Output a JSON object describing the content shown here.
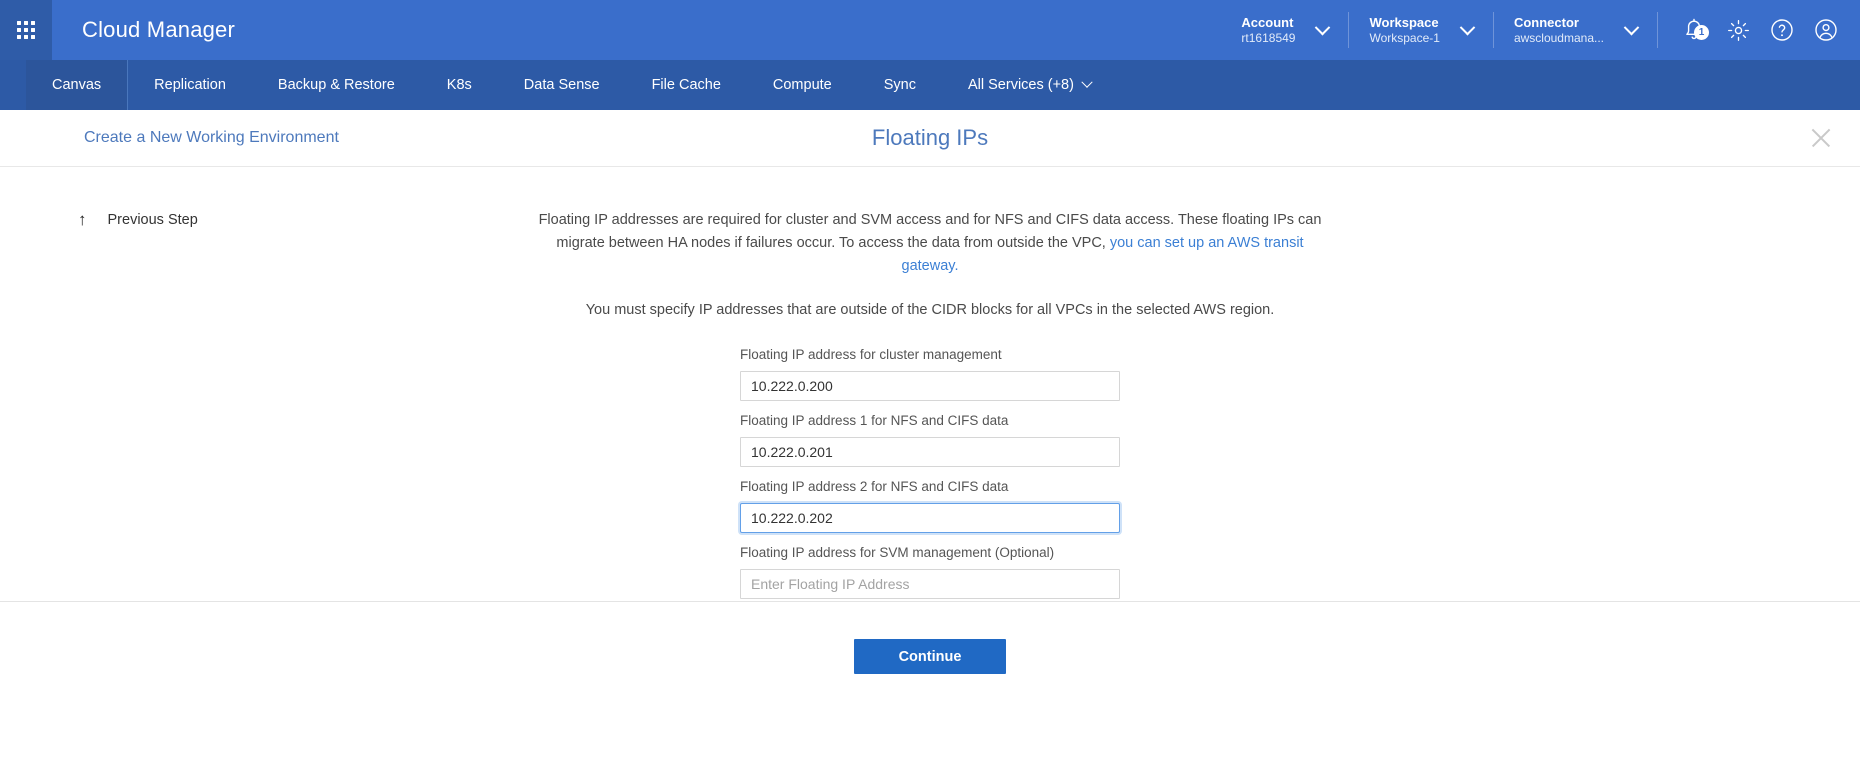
{
  "header": {
    "brand": "Cloud Manager",
    "apps_icon": "grid-apps-icon",
    "context": [
      {
        "label": "Account",
        "value": "rt1618549",
        "name": "account"
      },
      {
        "label": "Workspace",
        "value": "Workspace-1",
        "name": "workspace"
      },
      {
        "label": "Connector",
        "value": "awscloudmana...",
        "name": "connector"
      }
    ],
    "icons": {
      "notifications": "bell-icon",
      "notification_count": "1",
      "settings": "gear-icon",
      "help": "help-icon",
      "account": "user-avatar-icon"
    }
  },
  "nav": {
    "items": [
      {
        "label": "Canvas",
        "active": true
      },
      {
        "label": "Replication",
        "active": false
      },
      {
        "label": "Backup & Restore",
        "active": false
      },
      {
        "label": "K8s",
        "active": false
      },
      {
        "label": "Data Sense",
        "active": false
      },
      {
        "label": "File Cache",
        "active": false
      },
      {
        "label": "Compute",
        "active": false
      },
      {
        "label": "Sync",
        "active": false
      }
    ],
    "all_services": "All Services (+8)"
  },
  "page": {
    "breadcrumb": "Create a New Working Environment",
    "title": "Floating IPs",
    "close_icon": "close-icon",
    "previous_step": "Previous Step",
    "previous_step_icon": "arrow-up-icon"
  },
  "description": {
    "line1_part1": "Floating IP addresses are required for cluster and SVM access and for NFS and CIFS data access. These floating IPs can migrate between HA nodes if failures occur. To access the data from outside the VPC, ",
    "link_text": "you can set up an AWS transit gateway.",
    "line2": "You must specify IP addresses that are outside of the CIDR blocks for all VPCs in the selected AWS region."
  },
  "form": {
    "fields": [
      {
        "label": "Floating IP address for cluster management",
        "value": "10.222.0.200",
        "placeholder": "Enter Floating IP Address",
        "focused": false,
        "name": "cluster-management-ip"
      },
      {
        "label": "Floating IP address 1 for NFS and CIFS data",
        "value": "10.222.0.201",
        "placeholder": "Enter Floating IP Address",
        "focused": false,
        "name": "nfs-cifs-ip-1"
      },
      {
        "label": "Floating IP address 2 for NFS and CIFS data",
        "value": "10.222.0.202",
        "placeholder": "Enter Floating IP Address",
        "focused": true,
        "name": "nfs-cifs-ip-2"
      },
      {
        "label": "Floating IP address for SVM management (Optional)",
        "value": "",
        "placeholder": "Enter Floating IP Address",
        "focused": false,
        "name": "svm-management-ip"
      }
    ]
  },
  "footer": {
    "continue_label": "Continue"
  },
  "colors": {
    "header_blue": "#3a6ecb",
    "nav_blue": "#2d5aa6",
    "accent_link": "#3b7fd4",
    "title_blue": "#4d79bc",
    "button_blue": "#2069c4",
    "focus_border": "#63a0e8"
  }
}
